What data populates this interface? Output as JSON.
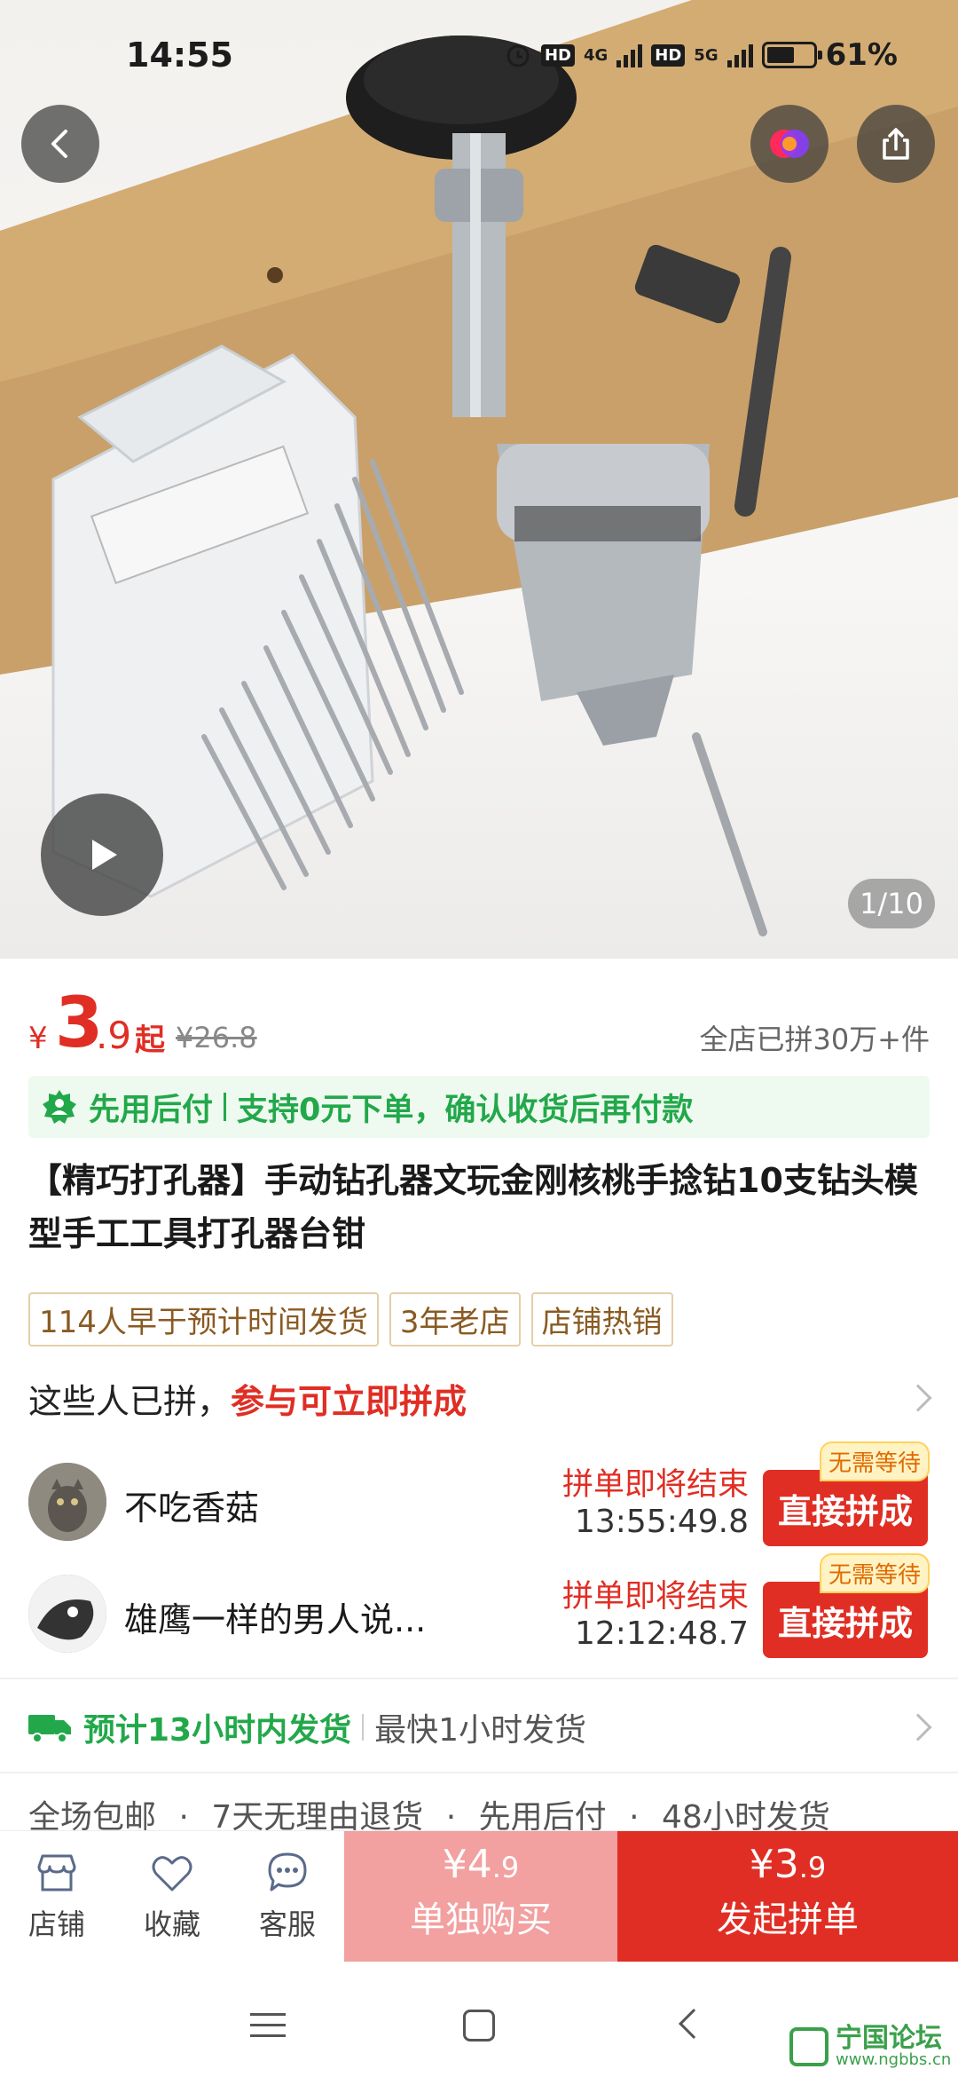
{
  "status_bar": {
    "time": "14:55",
    "hd1": "HD",
    "net1": "4G",
    "hd2": "HD",
    "net2": "5G",
    "battery": "61%"
  },
  "gallery": {
    "counter": "1/10"
  },
  "price": {
    "currency": "¥",
    "integer": "3",
    "decimal": ".9",
    "suffix": "起",
    "original": "¥26.8",
    "sold": "全店已拼30万+件"
  },
  "promo": {
    "label": "先用后付",
    "text": "支持0元下单，确认收货后再付款"
  },
  "product": {
    "title": "【精巧打孔器】手动钻孔器文玩金刚核桃手捻钻10支钻头模型手工工具打孔器台钳"
  },
  "tags": [
    "114人早于预计时间发货",
    "3年老店",
    "店铺热销"
  ],
  "group_buy": {
    "heading": "这些人已拼，",
    "heading_red": "参与可立即拼成",
    "rows": [
      {
        "name": "不吃香菇",
        "status": "拼单即将结束",
        "time": "13:55:49.8",
        "button": "直接拼成",
        "badge": "无需等待"
      },
      {
        "name": "雄鹰一样的男人说...",
        "status": "拼单即将结束",
        "time": "12:12:48.7",
        "button": "直接拼成",
        "badge": "无需等待"
      }
    ]
  },
  "shipping": {
    "estimate": "预计13小时内发货",
    "fastest": "最快1小时发货"
  },
  "services": [
    "全场包邮",
    "·",
    "7天无理由退货",
    "·",
    "先用后付",
    "·",
    "48小时发货"
  ],
  "bottom_bar": {
    "store": "店铺",
    "favorite": "收藏",
    "service": "客服",
    "alone_price": "¥4",
    "alone_price_dec": ".9",
    "alone_label": "单独购买",
    "group_price": "¥3",
    "group_price_dec": ".9",
    "group_label": "发起拼单"
  },
  "watermark": {
    "title": "宁国论坛",
    "url": "www.ngbbs.cn"
  },
  "colors": {
    "accent_red": "#e02e24",
    "green": "#22a84a",
    "light_red": "#f2a0a0"
  }
}
